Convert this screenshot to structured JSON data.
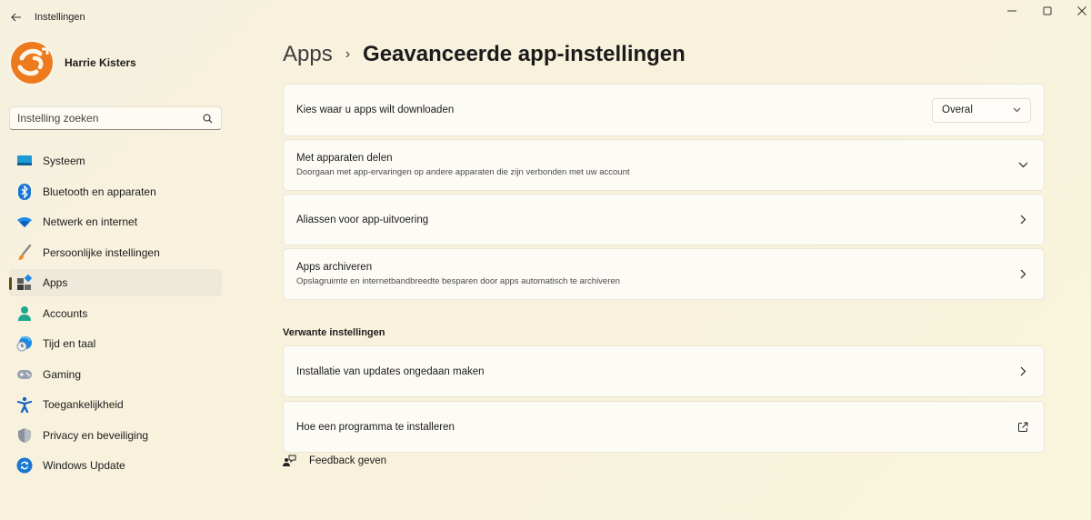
{
  "window": {
    "title": "Instellingen",
    "controls": [
      "minimize",
      "maximize",
      "close"
    ]
  },
  "profile": {
    "name": "Harrie Kisters",
    "avatar_icon": "orange-logo-avatar"
  },
  "search": {
    "placeholder": "Instelling zoeken",
    "value": ""
  },
  "sidebar": {
    "items": [
      {
        "label": "Systeem",
        "icon": "display-icon",
        "active": false
      },
      {
        "label": "Bluetooth en apparaten",
        "icon": "bluetooth-icon",
        "active": false
      },
      {
        "label": "Netwerk en internet",
        "icon": "wifi-icon",
        "active": false
      },
      {
        "label": "Persoonlijke instellingen",
        "icon": "brush-icon",
        "active": false
      },
      {
        "label": "Apps",
        "icon": "apps-icon",
        "active": true
      },
      {
        "label": "Accounts",
        "icon": "person-icon",
        "active": false
      },
      {
        "label": "Tijd en taal",
        "icon": "globe-clock-icon",
        "active": false
      },
      {
        "label": "Gaming",
        "icon": "gamepad-icon",
        "active": false
      },
      {
        "label": "Toegankelijkheid",
        "icon": "accessibility-icon",
        "active": false
      },
      {
        "label": "Privacy en beveiliging",
        "icon": "shield-icon",
        "active": false
      },
      {
        "label": "Windows Update",
        "icon": "update-icon",
        "active": false
      }
    ]
  },
  "header": {
    "breadcrumb_parent": "Apps",
    "separator": "›",
    "title": "Geavanceerde app-instellingen"
  },
  "settings": [
    {
      "title": "Kies waar u apps wilt downloaden",
      "subtitle": "",
      "control": "dropdown",
      "dropdown_value": "Overal"
    },
    {
      "title": "Met apparaten delen",
      "subtitle": "Doorgaan met app-ervaringen op andere apparaten die zijn verbonden met uw account",
      "control": "chevron-down"
    },
    {
      "title": "Aliassen voor app-uitvoering",
      "subtitle": "",
      "control": "chevron-right"
    },
    {
      "title": "Apps archiveren",
      "subtitle": "Opslagruimte en internetbandbreedte besparen door apps automatisch te archiveren",
      "control": "chevron-right"
    }
  ],
  "related": {
    "title": "Verwante instellingen",
    "items": [
      {
        "title": "Installatie van updates ongedaan maken",
        "control": "chevron-right"
      },
      {
        "title": "Hoe een programma te installeren",
        "control": "external-link"
      }
    ]
  },
  "feedback": {
    "label": "Feedback geven"
  },
  "colors": {
    "accent_orange": "#ee7a1e",
    "background": "#f7f1dd",
    "card": "#fdfbf5",
    "active_indicator": "#5a4a1a"
  }
}
